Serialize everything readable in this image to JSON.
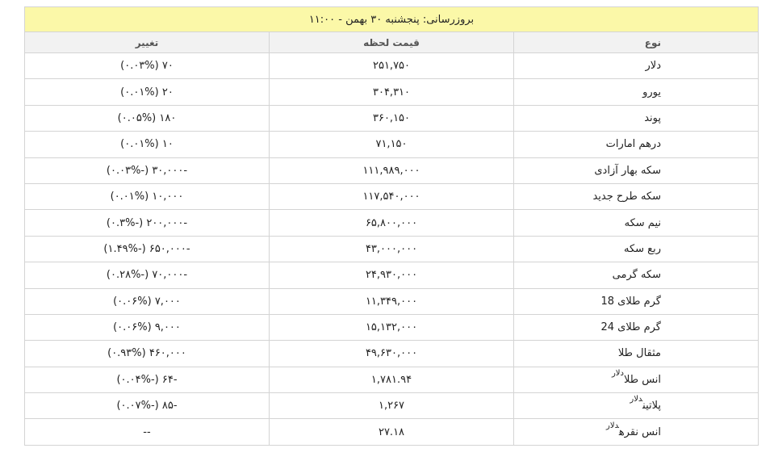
{
  "title": "بروزرسانی: پنجشنبه ۳۰ بهمن - ۱۱:۰۰",
  "headers": {
    "name": "نوع",
    "price": "قیمت لحظه",
    "change": "تغییر"
  },
  "rows": [
    {
      "name": "دلار",
      "unit": "",
      "price": "۲۵۱,۷۵۰",
      "change": "۷۰ (۰.۰۳%)",
      "dir": "up"
    },
    {
      "name": "یورو",
      "unit": "",
      "price": "۳۰۴,۳۱۰",
      "change": "۲۰ (۰.۰۱%)",
      "dir": "up"
    },
    {
      "name": "پوند",
      "unit": "",
      "price": "۳۶۰,۱۵۰",
      "change": "۱۸۰ (۰.۰۵%)",
      "dir": "up"
    },
    {
      "name": "درهم امارات",
      "unit": "",
      "price": "۷۱,۱۵۰",
      "change": "۱۰ (۰.۰۱%)",
      "dir": "up"
    },
    {
      "name": "سکه بهار آزادی",
      "unit": "",
      "price": "۱۱۱,۹۸۹,۰۰۰",
      "change": "-۳۰,۰۰۰ (-۰.۰۳%)",
      "dir": "down"
    },
    {
      "name": "سکه طرح جدید",
      "unit": "",
      "price": "۱۱۷,۵۴۰,۰۰۰",
      "change": "۱۰,۰۰۰ (۰.۰۱%)",
      "dir": "up"
    },
    {
      "name": "نیم سکه",
      "unit": "",
      "price": "۶۵,۸۰۰,۰۰۰",
      "change": "-۲۰۰,۰۰۰ (-۰.۳%)",
      "dir": "down"
    },
    {
      "name": "ربع سکه",
      "unit": "",
      "price": "۴۳,۰۰۰,۰۰۰",
      "change": "-۶۵۰,۰۰۰ (-۱.۴۹%)",
      "dir": "down"
    },
    {
      "name": "سکه گرمی",
      "unit": "",
      "price": "۲۴,۹۳۰,۰۰۰",
      "change": "-۷۰,۰۰۰ (-۰.۲۸%)",
      "dir": "down"
    },
    {
      "name": "گرم طلای 18",
      "unit": "",
      "price": "۱۱,۳۴۹,۰۰۰",
      "change": "۷,۰۰۰ (۰.۰۶%)",
      "dir": "up"
    },
    {
      "name": "گرم طلای 24",
      "unit": "",
      "price": "۱۵,۱۳۲,۰۰۰",
      "change": "۹,۰۰۰ (۰.۰۶%)",
      "dir": "up"
    },
    {
      "name": "مثقال طلا",
      "unit": "",
      "price": "۴۹,۶۳۰,۰۰۰",
      "change": "۴۶۰,۰۰۰ (۰.۹۳%)",
      "dir": "up"
    },
    {
      "name": "انس طلا",
      "unit": "دلار",
      "price": "۱,۷۸۱.۹۴",
      "change": "-۶۴ (-۰.۰۴%)",
      "dir": "down"
    },
    {
      "name": "پلاتین",
      "unit": "دلار",
      "price": "۱,۲۶۷",
      "change": "-۸۵ (-۰.۰۷%)",
      "dir": "down"
    },
    {
      "name": "انس نقره",
      "unit": "دلار",
      "price": "۲۷.۱۸",
      "change": "--",
      "dir": "flat"
    }
  ]
}
